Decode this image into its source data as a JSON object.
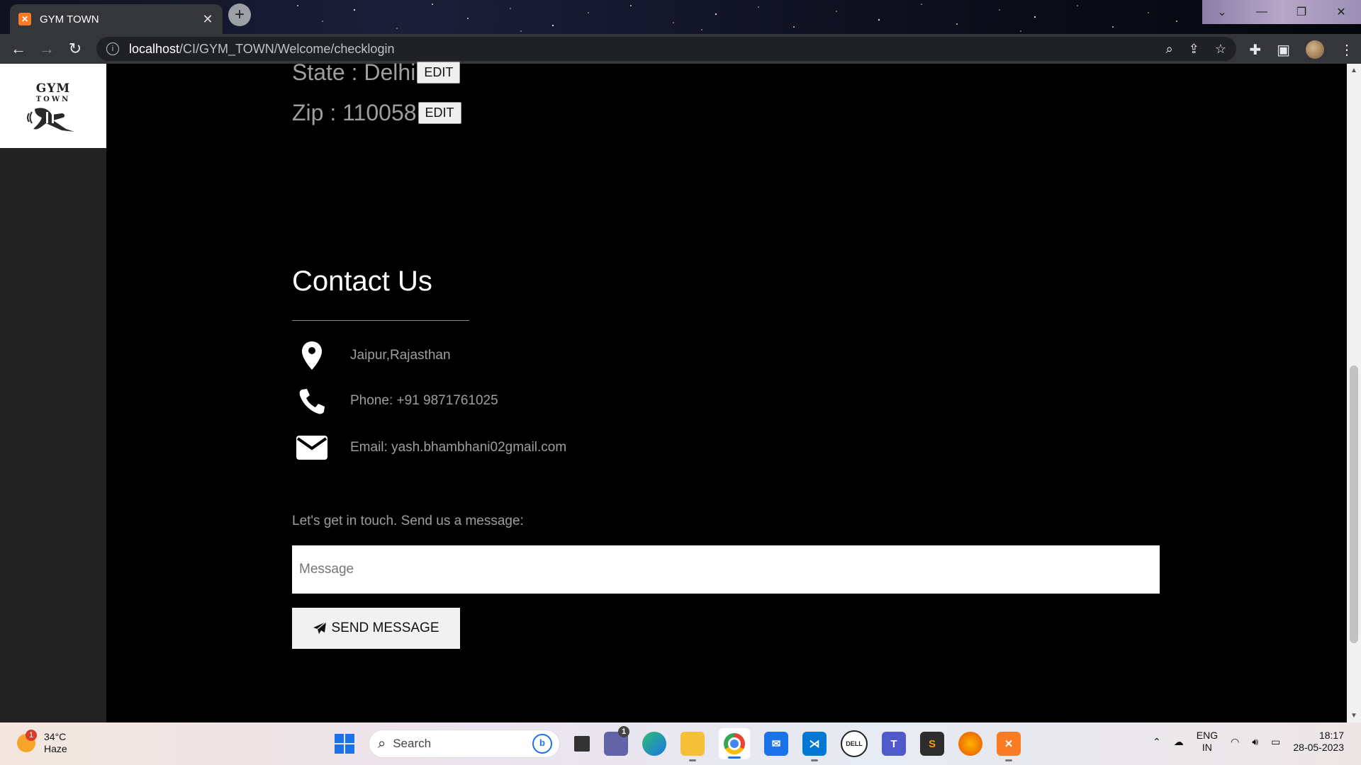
{
  "browser": {
    "tab_title": "GYM TOWN",
    "tab_favicon_text": "✕",
    "url_host": "localhost",
    "url_path": "/CI/GYM_TOWN/Welcome/checklogin"
  },
  "logo": {
    "line1": "GYM",
    "line2": "TOWN"
  },
  "profile_fields": [
    {
      "label": "State : Delhi",
      "edit_label": "EDIT"
    },
    {
      "label": "Zip : 110058",
      "edit_label": "EDIT"
    }
  ],
  "contact": {
    "title": "Contact Us",
    "address": "Jaipur,Rajasthan",
    "phone": "Phone: +91 9871761025",
    "email": "Email: yash.bhambhani02gmail.com",
    "touch_text": "Let's get in touch. Send us a message:",
    "message_placeholder": "Message",
    "send_label": "SEND MESSAGE"
  },
  "taskbar": {
    "weather_temp": "34°C",
    "weather_desc": "Haze",
    "weather_badge": "1",
    "search_label": "Search",
    "teams_badge": "1",
    "lang_1": "ENG",
    "lang_2": "IN",
    "time": "18:17",
    "date": "28-05-2023"
  },
  "colors": {
    "page_bg": "#000000",
    "sidebar_bg": "#222222",
    "muted_text": "#9e9e9e",
    "accent_blue": "#1a73e8"
  }
}
